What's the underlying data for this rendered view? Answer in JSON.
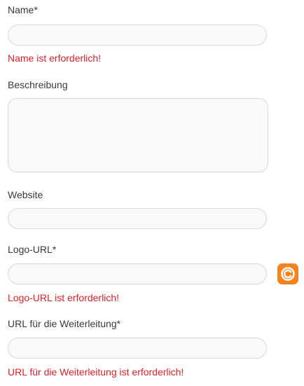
{
  "form": {
    "name": {
      "label": "Name*",
      "value": "",
      "placeholder": "",
      "error": "Name ist erforderlich!"
    },
    "description": {
      "label": "Beschreibung",
      "value": "",
      "placeholder": ""
    },
    "website": {
      "label": "Website",
      "value": "",
      "placeholder": ""
    },
    "logo_url": {
      "label": "Logo-URL*",
      "value": "",
      "placeholder": "",
      "error": "Logo-URL ist erforderlich!"
    },
    "redirect_url": {
      "label": "URL für die Weiterleitung*",
      "value": "",
      "placeholder": "",
      "error": "URL für die Weiterleitung ist erforderlich!"
    }
  },
  "extension_icon": {
    "icon": "circular-c-logo-icon",
    "color": "#f5821f"
  },
  "colors": {
    "error": "#e2202a",
    "label": "#3a3a3a",
    "input_border": "#d9d9d9",
    "input_background": "#f9f9f9"
  }
}
